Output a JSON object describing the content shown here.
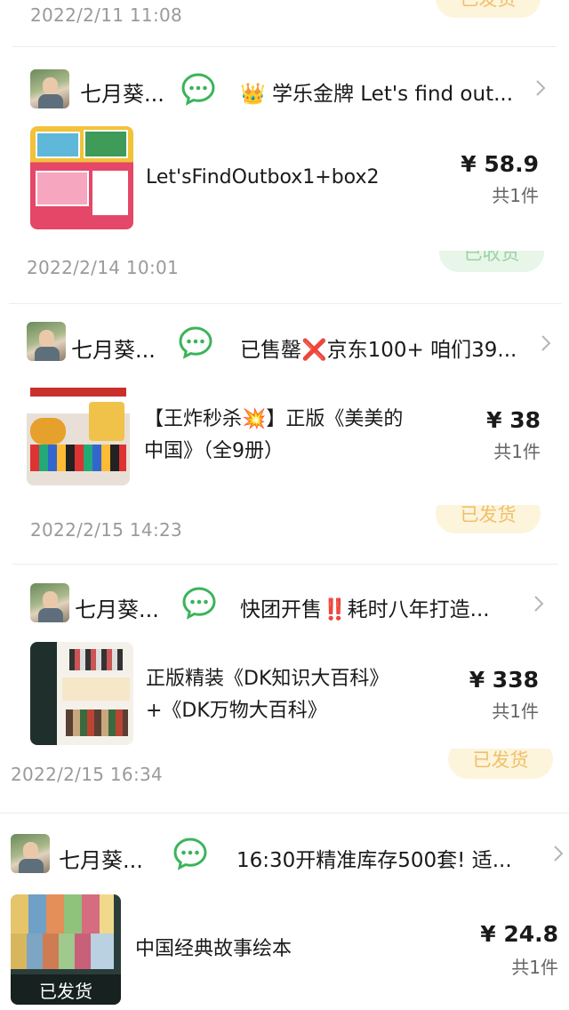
{
  "colors": {
    "wechat_green": "#3bb45a",
    "badge_orange_bg": "#fdf4dc",
    "badge_orange_text": "#f0c068",
    "badge_green_bg": "#e8f6ea",
    "badge_green_text": "#9ad2a3"
  },
  "orders": [
    {
      "date": "2022/2/11 11:08",
      "status": "已发货",
      "user": "七月葵...",
      "group_title": "👑 学乐金牌 Let's find out...",
      "product": "Let'sFindOutbox1+box2",
      "price": "¥ 58.9",
      "qty": "共1件"
    },
    {
      "date": "2022/2/14 10:01",
      "status": "已收货",
      "user": "七月葵...",
      "group_title": "已售罄❌京东100+ 咱们39...",
      "product": "【王炸秒杀💥】正版《美美的中国》（全9册）",
      "price": "¥ 38",
      "qty": "共1件"
    },
    {
      "date": "2022/2/15 14:23",
      "status": "已发货",
      "user": "七月葵...",
      "group_title": "快团开售‼️耗时八年打造...",
      "product": "正版精装《DK知识大百科》+《DK万物大百科》",
      "price": "¥ 338",
      "qty": "共1件"
    },
    {
      "date": "2022/2/15 16:34",
      "status": "已发货",
      "user": "七月葵...",
      "group_title": "16:30开精准库存500套! 适...",
      "product": "中国经典故事绘本",
      "price": "¥ 24.8",
      "qty": "共1件",
      "thumb_overlay": "已发货"
    }
  ]
}
